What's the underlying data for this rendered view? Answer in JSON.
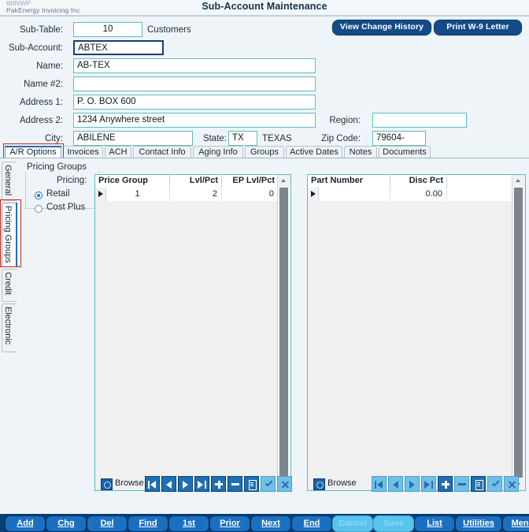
{
  "window": {
    "app_code": "WINWP",
    "company": "PakEnergy Invoicing Inc",
    "title": "Sub-Account Maintenance"
  },
  "header_buttons": [
    {
      "label": "View Change History",
      "name": "view-change-history-button"
    },
    {
      "label": "Print W-9 Letter",
      "name": "print-w9-letter-button"
    }
  ],
  "form": {
    "sub_table": {
      "label": "Sub-Table:",
      "value": "10",
      "suffix": "Customers"
    },
    "sub_account": {
      "label": "Sub-Account:",
      "value": "ABTEX"
    },
    "name": {
      "label": "Name:",
      "value": "AB-TEX"
    },
    "name2": {
      "label": "Name #2:",
      "value": ""
    },
    "address1": {
      "label": "Address 1:",
      "value": "P. O. BOX 600"
    },
    "address2": {
      "label": "Address 2:",
      "value": "1234 Anywhere street"
    },
    "city": {
      "label": "City:",
      "value": "ABILENE"
    },
    "state": {
      "label": "State:",
      "value": "TX",
      "description": "TEXAS"
    },
    "region": {
      "label": "Region:",
      "value": ""
    },
    "zip": {
      "label": "Zip Code:",
      "value": "79604-"
    }
  },
  "tabs": {
    "selected": "A/R Options",
    "items": [
      {
        "label": "A/R Options",
        "name": "tab-ar-options"
      },
      {
        "label": "Invoices",
        "name": "tab-invoices"
      },
      {
        "label": "ACH",
        "name": "tab-ach"
      },
      {
        "label": "Contact Info",
        "name": "tab-contact-info"
      },
      {
        "label": "Aging Info",
        "name": "tab-aging-info"
      },
      {
        "label": "Groups",
        "name": "tab-groups"
      },
      {
        "label": "Active Dates",
        "name": "tab-active-dates"
      },
      {
        "label": "Notes",
        "name": "tab-notes"
      },
      {
        "label": "Documents",
        "name": "tab-documents"
      }
    ]
  },
  "side_tabs": {
    "selected": "Pricing Groups",
    "items": [
      {
        "label": "General",
        "name": "side-tab-general"
      },
      {
        "label": "Pricing Groups",
        "name": "side-tab-pricing-groups"
      },
      {
        "label": "Credit",
        "name": "side-tab-credit"
      },
      {
        "label": "Electronic",
        "name": "side-tab-electronic"
      }
    ]
  },
  "pricing_groups": {
    "group_label": "Pricing Groups",
    "pricing_label": "Pricing:",
    "options": [
      {
        "label": "Retail",
        "selected": true,
        "name": "radio-retail"
      },
      {
        "label": "Cost Plus",
        "selected": false,
        "name": "radio-cost-plus"
      }
    ]
  },
  "price_group_grid": {
    "columns": [
      "Price Group",
      "Lvl/Pct",
      "EP Lvl/Pct"
    ],
    "rows": [
      {
        "price_group": "1",
        "lvl_pct": "2",
        "ep_lvl_pct": "0"
      }
    ],
    "navigator_label": "Browse"
  },
  "part_grid": {
    "columns": [
      "Part Number",
      "Disc Pct"
    ],
    "rows": [
      {
        "part_number": "",
        "disc_pct": "0.00"
      }
    ],
    "navigator_label": "Browse"
  },
  "navigator_buttons": [
    {
      "name": "nav-first-button",
      "glyph": "first"
    },
    {
      "name": "nav-prev-button",
      "glyph": "prev"
    },
    {
      "name": "nav-next-button",
      "glyph": "next"
    },
    {
      "name": "nav-last-button",
      "glyph": "last"
    },
    {
      "name": "nav-insert-button",
      "glyph": "plus"
    },
    {
      "name": "nav-delete-button",
      "glyph": "minus"
    },
    {
      "name": "nav-edit-button",
      "glyph": "doc"
    },
    {
      "name": "nav-post-button",
      "glyph": "check"
    },
    {
      "name": "nav-cancel-button",
      "glyph": "cross"
    }
  ],
  "bottom_bar": {
    "buttons": [
      {
        "label": "Add",
        "accel": "A",
        "name": "add-button",
        "enabled": true
      },
      {
        "label": "Chg",
        "accel": "C",
        "name": "chg-button",
        "enabled": true
      },
      {
        "label": "Del",
        "accel": "D",
        "name": "del-button",
        "enabled": true
      },
      {
        "label": "Find",
        "accel": "F",
        "name": "find-button",
        "enabled": true
      },
      {
        "label": "1st",
        "accel": "1",
        "name": "first-button",
        "enabled": true
      },
      {
        "label": "Prior",
        "accel": "P",
        "name": "prior-button",
        "enabled": true
      },
      {
        "label": "Next",
        "accel": "N",
        "name": "next-button",
        "enabled": true
      },
      {
        "label": "End",
        "accel": "E",
        "name": "end-button",
        "enabled": true
      },
      {
        "label": "Cancel",
        "accel": "",
        "name": "cancel-button",
        "enabled": false
      },
      {
        "label": "Save",
        "accel": "",
        "name": "save-button",
        "enabled": false
      },
      {
        "label": "List",
        "accel": "L",
        "name": "list-button",
        "enabled": true
      },
      {
        "label": "Utilities",
        "accel": "U",
        "name": "utilities-button",
        "enabled": true
      },
      {
        "label": "Menu",
        "accel": "M",
        "name": "menu-button",
        "enabled": true
      }
    ]
  },
  "colors": {
    "accent_blue": "#1f6fb2",
    "field_border": "#5bbec4",
    "highlight_red": "#d4241c",
    "bottom_bar": "#0b3e73",
    "background": "#eef4f8"
  }
}
